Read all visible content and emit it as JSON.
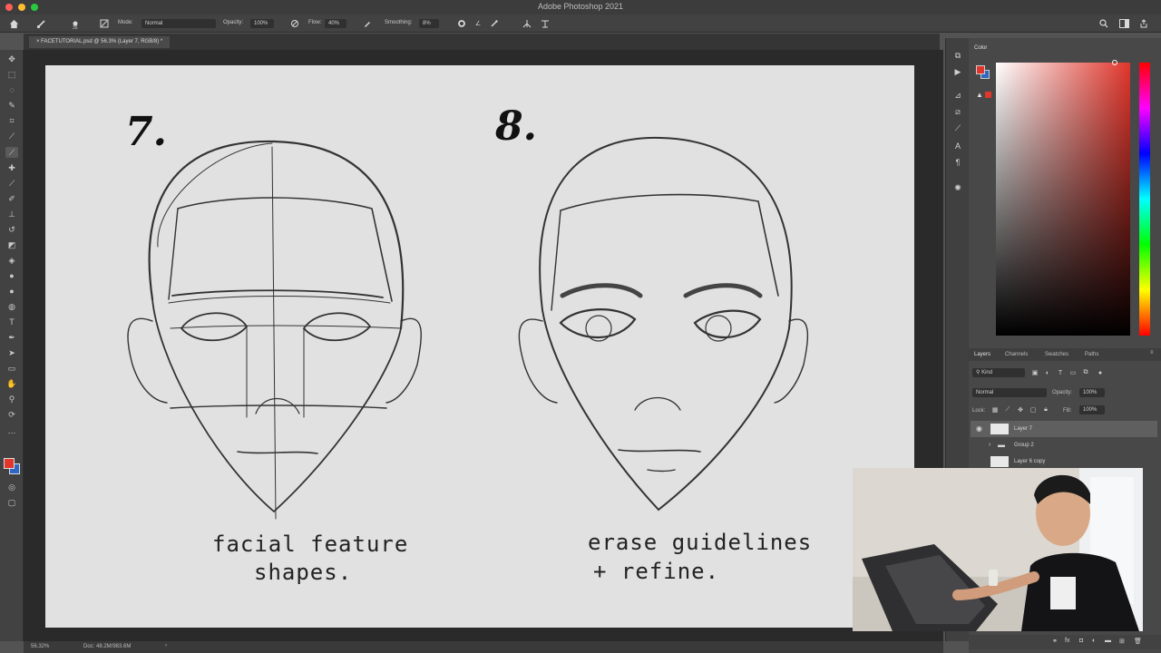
{
  "app": {
    "title": "Adobe Photoshop 2021",
    "colors": {
      "close": "#ff5f57",
      "minimize": "#febc2e",
      "maximize": "#28c840",
      "foreground": "#e0362c"
    }
  },
  "options": {
    "mode_label": "Mode:",
    "mode_value": "Normal",
    "opacity_label": "Opacity:",
    "opacity_value": "100%",
    "flow_label": "Flow:",
    "flow_value": "40%",
    "smoothing_label": "Smoothing:",
    "smoothing_value": "8%",
    "brush_size": "35"
  },
  "document": {
    "tab_title": "FACETUTORIAL.psd @ 56.3% (Layer 7, RGB/8) *"
  },
  "canvas": {
    "step1_number": "7.",
    "step1_caption_line1": "facial feature",
    "step1_caption_line2": "shapes.",
    "step2_number": "8.",
    "step2_caption_line1": "erase guidelines",
    "step2_caption_line2": "+ refine."
  },
  "status": {
    "zoom": "56.32%",
    "doc_info": "Doc: 48.2M/983.6M"
  },
  "panels": {
    "color_title": "Color",
    "tabs": [
      "Layers",
      "Channels",
      "Swatches",
      "Paths"
    ],
    "filter_kind": "Kind",
    "blend_mode": "Normal",
    "opacity_label": "Opacity:",
    "opacity_value": "100%",
    "lock_label": "Lock:",
    "fill_label": "Fill:",
    "fill_value": "100%",
    "layers": [
      "Layer 7",
      "Group 2",
      "Layer 6 copy"
    ]
  }
}
